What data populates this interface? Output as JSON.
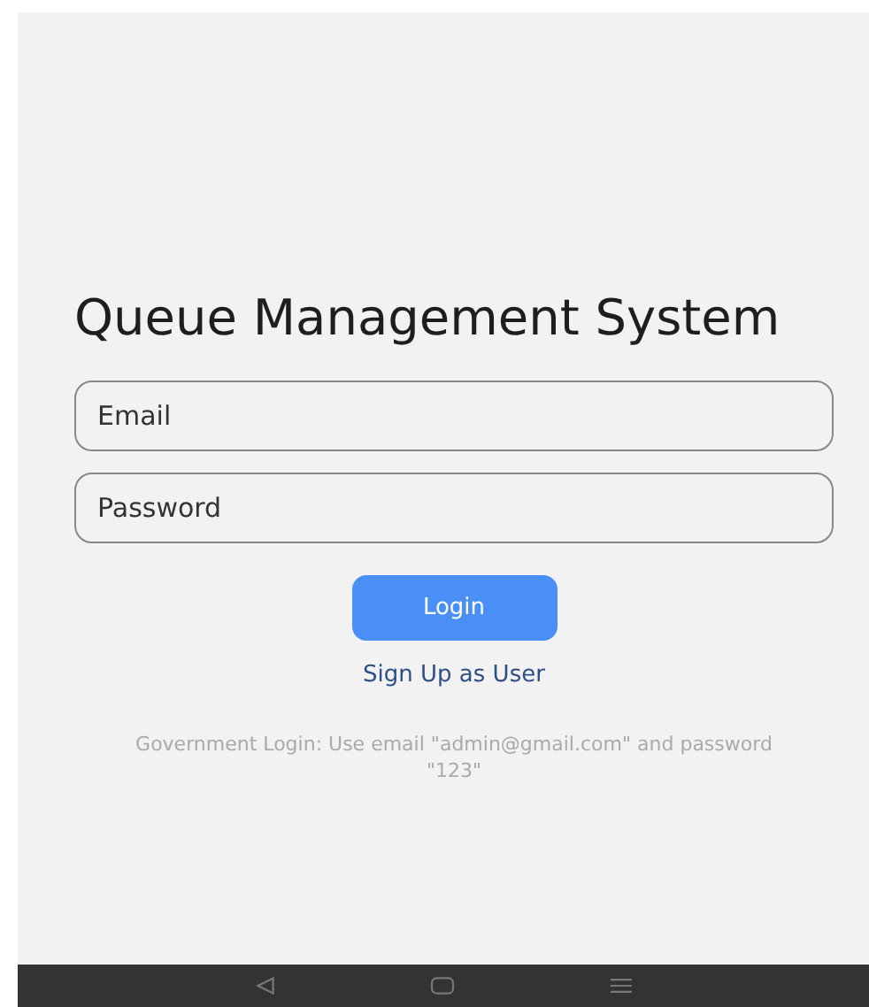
{
  "title": "Queue Management System",
  "fields": [
    {
      "placeholder": "Email"
    },
    {
      "placeholder": "Password"
    }
  ],
  "login_button": "Login",
  "signup_link": "Sign Up as User",
  "note": "Government Login: Use email \"admin@gmail.com\" and password \"123\"",
  "nav_bar": {
    "buttons": [
      {
        "kind": "back"
      },
      {
        "kind": "home"
      },
      {
        "kind": "menu"
      }
    ]
  }
}
